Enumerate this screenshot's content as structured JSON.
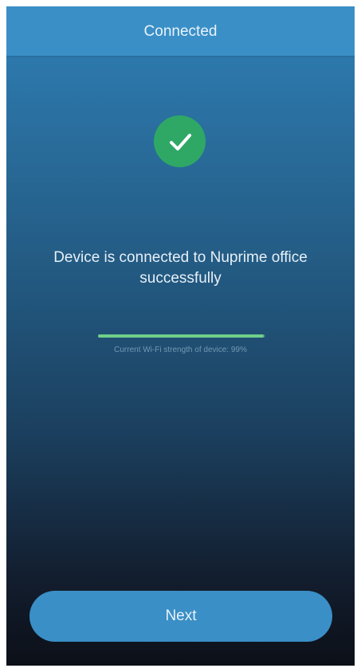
{
  "header": {
    "title": "Connected"
  },
  "status": {
    "icon": "checkmark-circle-icon",
    "icon_color": "#2fa866",
    "message": "Device is connected to Nuprime office successfully"
  },
  "wifi": {
    "strength_text": "Current Wi-Fi strength of device: 99%",
    "strength_value": 0.99,
    "bar_color": "#6fd08a"
  },
  "actions": {
    "next_label": "Next",
    "button_color": "#3a8fc6"
  }
}
